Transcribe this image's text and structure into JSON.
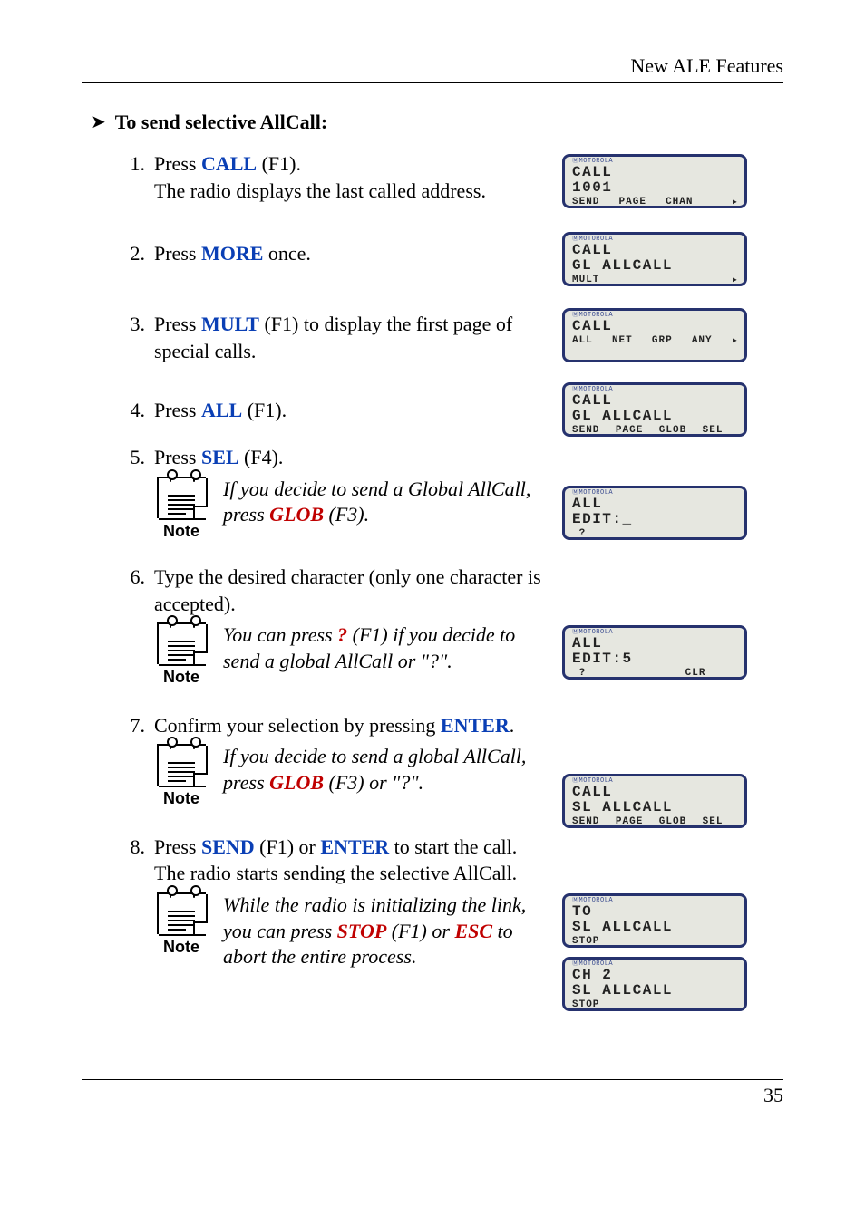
{
  "header": {
    "title": "New ALE Features"
  },
  "section": {
    "pointer": "➤",
    "title": "To send selective AllCall:"
  },
  "steps": {
    "s1": {
      "num": "1.",
      "pre": "Press ",
      "kw": "CALL",
      "post": " (F1).",
      "line2": "The radio displays the last called address."
    },
    "s2": {
      "num": "2.",
      "pre": "Press ",
      "kw": "MORE",
      "post": " once."
    },
    "s3": {
      "num": "3.",
      "pre": "Press ",
      "kw": "MULT",
      "post": " (F1) to display the first page of special calls."
    },
    "s4": {
      "num": "4.",
      "pre": "Press ",
      "kw": "ALL",
      "post": " (F1)."
    },
    "s5": {
      "num": "5.",
      "pre": "Press ",
      "kw": "SEL",
      "post": " (F4)."
    },
    "s6": {
      "num": "6.",
      "text": "Type the desired character (only one character is accepted)."
    },
    "s7": {
      "num": "7.",
      "pre": "Confirm your selection by pressing ",
      "kw": "ENTER",
      "post": "."
    },
    "s8": {
      "num": "8.",
      "pre": "Press ",
      "kw1": "SEND",
      "mid": " (F1) or ",
      "kw2": "ENTER",
      "post": " to start the call. The radio starts sending the selective AllCall."
    }
  },
  "notes": {
    "label": "Note",
    "n5": {
      "pre": "If you decide to send a Global AllCall, press ",
      "kw": "GLOB",
      "post": " (F3)."
    },
    "n6": {
      "pre": "You can press ",
      "kw": "?",
      "post": " (F1) if you decide to send a global AllCall or \"?\"."
    },
    "n7": {
      "pre": "If you decide to send a global AllCall, press ",
      "kw": "GLOB",
      "post": " (F3) or \"?\"."
    },
    "n8": {
      "pre": "While the radio is initializing the link, you can press ",
      "kw1": "STOP",
      "mid": " (F1) or ",
      "kw2": "ESC",
      "post": " to abort the entire process."
    }
  },
  "brand": "ⓂMOTOROLA",
  "screens": {
    "sc1": {
      "l1": "CALL",
      "l2": "1001",
      "f1": "SEND",
      "f2": "PAGE",
      "f3": "CHAN",
      "f4": "",
      "more": "▸"
    },
    "sc2": {
      "l1": "CALL",
      "l2": "GL ALLCALL",
      "f1": "MULT",
      "f2": "",
      "f3": "",
      "f4": "",
      "more": "▸"
    },
    "sc3": {
      "l1": "CALL",
      "l2": "",
      "f1": "ALL",
      "f2": "NET",
      "f3": "GRP",
      "f4": "ANY",
      "more": "▸"
    },
    "sc4": {
      "l1": "CALL",
      "l2": "GL ALLCALL",
      "f1": "SEND",
      "f2": "PAGE",
      "f3": "GLOB",
      "f4": "SEL",
      "more": ""
    },
    "sc5": {
      "l1": "ALL",
      "l2": "EDIT:_",
      "f1": " ?",
      "f2": "",
      "f3": "",
      "f4": "",
      "more": ""
    },
    "sc6": {
      "l1": "ALL",
      "l2": "EDIT:5",
      "f1": " ?",
      "f2": "",
      "f3": "",
      "f4": "CLR",
      "more": ""
    },
    "sc7": {
      "l1": "CALL",
      "l2": "SL ALLCALL",
      "f1": "SEND",
      "f2": "PAGE",
      "f3": "GLOB",
      "f4": "SEL",
      "more": ""
    },
    "sc8": {
      "l1": "TO",
      "l2": "SL ALLCALL",
      "f1": "STOP",
      "f2": "",
      "f3": "",
      "f4": "",
      "more": ""
    },
    "sc9": {
      "l1": "CH 2",
      "l2": "SL ALLCALL",
      "f1": "STOP",
      "f2": "",
      "f3": "",
      "f4": "",
      "more": ""
    }
  },
  "footer": {
    "page": "35"
  }
}
